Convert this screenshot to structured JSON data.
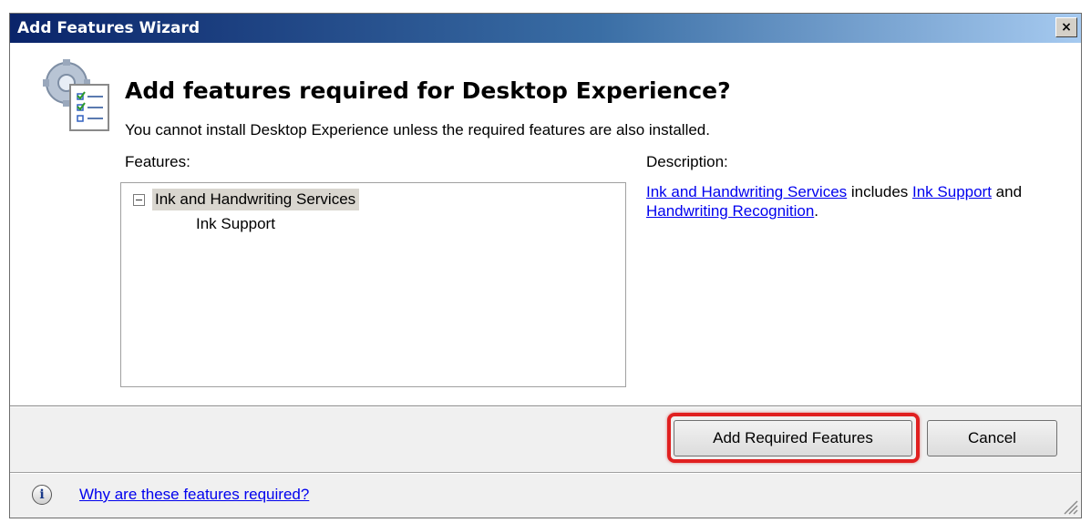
{
  "window": {
    "title": "Add Features Wizard",
    "close_glyph": "×"
  },
  "header": {
    "icon": "features-checklist-icon",
    "title": "Add features required for Desktop Experience?",
    "message": "You cannot install Desktop Experience unless the required features are also installed."
  },
  "features": {
    "label": "Features:",
    "tree": [
      {
        "label": "Ink and Handwriting Services",
        "expanded": true,
        "selected": true,
        "children": [
          {
            "label": "Ink Support"
          }
        ]
      }
    ]
  },
  "description": {
    "label": "Description:",
    "link1": "Ink and Handwriting Services",
    "text1": " includes ",
    "link2": "Ink Support",
    "text2": " and ",
    "link3": "Handwriting Recognition",
    "text3": "."
  },
  "buttons": {
    "add_required": "Add Required Features",
    "cancel": "Cancel"
  },
  "footer": {
    "info_icon": "info-icon",
    "link": "Why are these features required?"
  },
  "colors": {
    "title_gradient_start": "#0a246a",
    "title_gradient_end": "#a6caf0",
    "link": "#0000ee",
    "highlight": "#e02020"
  }
}
